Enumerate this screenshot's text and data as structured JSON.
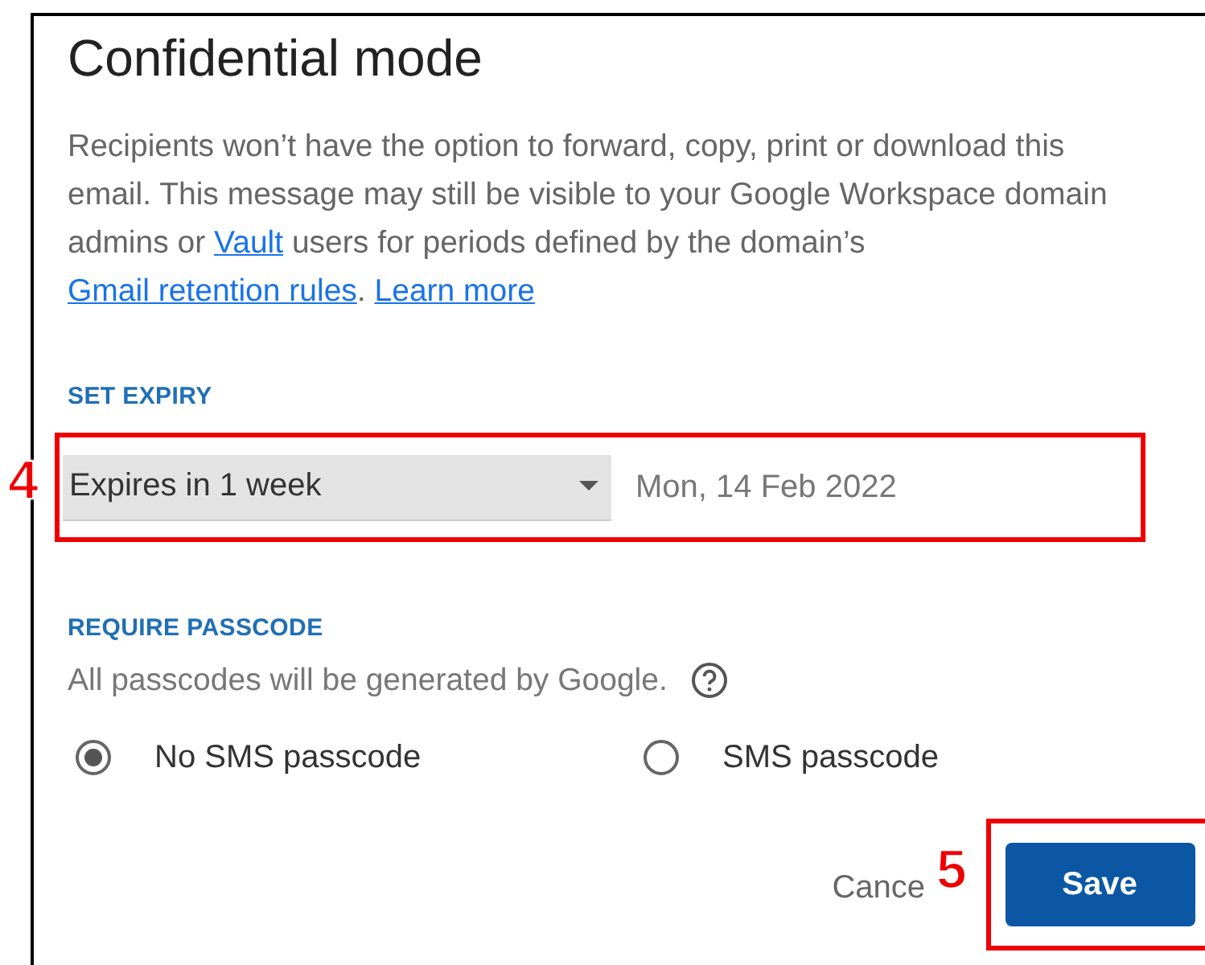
{
  "dialog": {
    "title": "Confidential mode",
    "description": {
      "parts": [
        {
          "kind": "text",
          "text": "Recipients won’t have the option to forward, copy, print or download this email. This message may still be visible to your Google Workspace domain admins or "
        },
        {
          "kind": "link",
          "text": "Vault"
        },
        {
          "kind": "text",
          "text": " users for periods defined by the domain’s "
        },
        {
          "kind": "link",
          "text": "Gmail retention rules"
        },
        {
          "kind": "text",
          "text": ". "
        },
        {
          "kind": "link",
          "text": "Learn more"
        }
      ]
    },
    "expiry": {
      "heading": "SET EXPIRY",
      "select_value": "Expires in 1 week",
      "date": "Mon, 14 Feb 2022",
      "callout": "4"
    },
    "passcode": {
      "heading": "REQUIRE PASSCODE",
      "note": "All passcodes will be generated by Google.",
      "options": [
        {
          "label": "No SMS passcode",
          "selected": true
        },
        {
          "label": "SMS passcode",
          "selected": false
        }
      ]
    },
    "buttons": {
      "cancel": "Cance",
      "save": "Save",
      "callout": "5"
    }
  }
}
